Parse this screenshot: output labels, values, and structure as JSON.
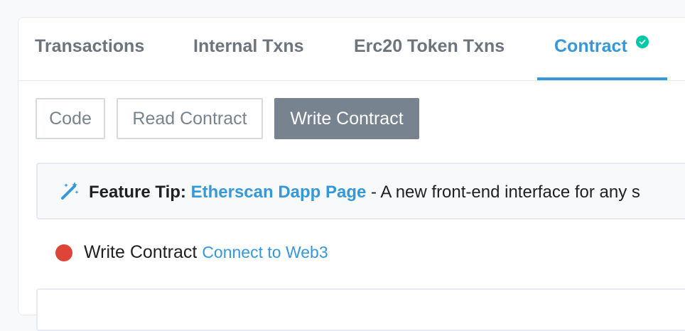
{
  "tabs": [
    {
      "label": "Transactions",
      "active": false
    },
    {
      "label": "Internal Txns",
      "active": false
    },
    {
      "label": "Erc20 Token Txns",
      "active": false
    },
    {
      "label": "Contract",
      "active": true,
      "badge_icon": "check-circle-icon"
    }
  ],
  "subtabs": [
    {
      "label": "Code",
      "active": false
    },
    {
      "label": "Read Contract",
      "active": false
    },
    {
      "label": "Write Contract",
      "active": true
    }
  ],
  "tip": {
    "icon": "magic-wand-icon",
    "prefix": "Feature Tip:",
    "link": "Etherscan Dapp Page",
    "text": " - A new front-end interface for any s"
  },
  "status": {
    "icon": "status-dot",
    "color": "#de4437",
    "label": "Write Contract",
    "link": "Connect to Web3"
  },
  "colors": {
    "accent": "#3498db",
    "verified": "#00c9a7",
    "active_button": "#77838f",
    "error": "#de4437"
  }
}
